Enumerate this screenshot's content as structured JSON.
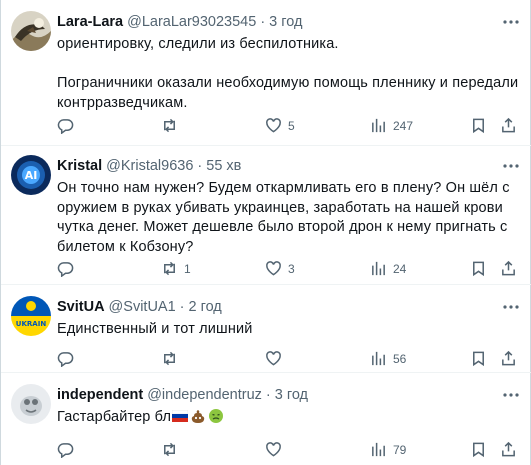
{
  "tweets": [
    {
      "name": "Lara-Lara",
      "handle": "@LaraLar93023545",
      "separator": "·",
      "time": "3 год",
      "text": "ориентировку, следили из беспилотника.\n\nПограничники оказали необходимую помощь пленнику и передали контрразведчикам.",
      "replies": "",
      "retweets": "",
      "likes": "5",
      "views": "247"
    },
    {
      "name": "Kristal",
      "handle": "@Kristal9636",
      "separator": "·",
      "time": "55 хв",
      "text": "Он точно нам нужен? Будем откармливать его в плену? Он шёл с оружием в руках убивать украинцев, заработать на нашей крови чутка денег. Может дешевле было второй дрон к нему пригнать с билетом к Кобзону?",
      "replies": "",
      "retweets": "1",
      "likes": "3",
      "views": "24"
    },
    {
      "name": "SvitUA",
      "handle": "@SvitUA1",
      "separator": "·",
      "time": "2 год",
      "text": "Единственный и тот лишний",
      "replies": "",
      "retweets": "",
      "likes": "",
      "views": "56"
    },
    {
      "name": "independent",
      "handle": "@independentruz",
      "separator": "·",
      "time": "3 год",
      "text": "Гастарбайтер бл",
      "replies": "",
      "retweets": "",
      "likes": "",
      "views": "79"
    }
  ],
  "avatar_texts": {
    "kristal": "AI",
    "svitua": "UKRAIN"
  },
  "colors": {
    "text": "#0f1419",
    "secondary": "#536471",
    "border": "#eff3f4"
  }
}
